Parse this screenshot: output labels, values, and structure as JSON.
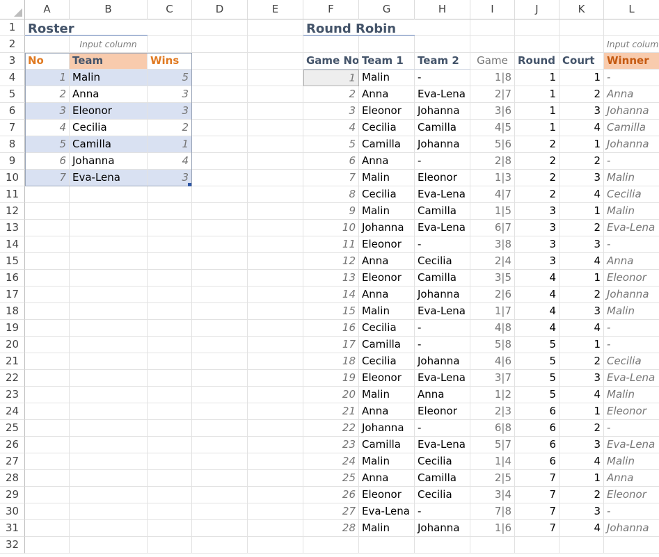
{
  "columns": [
    "A",
    "B",
    "C",
    "D",
    "E",
    "F",
    "G",
    "H",
    "I",
    "J",
    "K",
    "L"
  ],
  "rows": [
    1,
    2,
    3,
    4,
    5,
    6,
    7,
    8,
    9,
    10,
    11,
    12,
    13,
    14,
    15,
    16,
    17,
    18,
    19,
    20,
    21,
    22,
    23,
    24,
    25,
    26,
    27,
    28,
    29,
    30,
    31,
    32
  ],
  "roster": {
    "title": "Roster",
    "input_label": "Input column",
    "headers": {
      "no": "No",
      "team": "Team",
      "wins": "Wins"
    },
    "teams": [
      {
        "no": 1,
        "team": "Malin",
        "wins": 5
      },
      {
        "no": 2,
        "team": "Anna",
        "wins": 3
      },
      {
        "no": 3,
        "team": "Eleonor",
        "wins": 3
      },
      {
        "no": 4,
        "team": "Cecilia",
        "wins": 2
      },
      {
        "no": 5,
        "team": "Camilla",
        "wins": 1
      },
      {
        "no": 6,
        "team": "Johanna",
        "wins": 4
      },
      {
        "no": 7,
        "team": "Eva-Lena",
        "wins": 3
      }
    ]
  },
  "round_robin": {
    "title": "Round Robin",
    "input_label": "Input column",
    "headers": {
      "game_no": "Game No",
      "team1": "Team 1",
      "team2": "Team 2",
      "game": "Game",
      "round": "Round",
      "court": "Court",
      "winner": "Winner"
    },
    "games": [
      {
        "no": 1,
        "team1": "Malin",
        "team2": "-",
        "game": "1|8",
        "round": 1,
        "court": 1,
        "winner": "-"
      },
      {
        "no": 2,
        "team1": "Anna",
        "team2": "Eva-Lena",
        "game": "2|7",
        "round": 1,
        "court": 2,
        "winner": "Anna"
      },
      {
        "no": 3,
        "team1": "Eleonor",
        "team2": "Johanna",
        "game": "3|6",
        "round": 1,
        "court": 3,
        "winner": "Johanna"
      },
      {
        "no": 4,
        "team1": "Cecilia",
        "team2": "Camilla",
        "game": "4|5",
        "round": 1,
        "court": 4,
        "winner": "Camilla"
      },
      {
        "no": 5,
        "team1": "Camilla",
        "team2": "Johanna",
        "game": "5|6",
        "round": 2,
        "court": 1,
        "winner": "Johanna"
      },
      {
        "no": 6,
        "team1": "Anna",
        "team2": "-",
        "game": "2|8",
        "round": 2,
        "court": 2,
        "winner": "-"
      },
      {
        "no": 7,
        "team1": "Malin",
        "team2": "Eleonor",
        "game": "1|3",
        "round": 2,
        "court": 3,
        "winner": "Malin"
      },
      {
        "no": 8,
        "team1": "Cecilia",
        "team2": "Eva-Lena",
        "game": "4|7",
        "round": 2,
        "court": 4,
        "winner": "Cecilia"
      },
      {
        "no": 9,
        "team1": "Malin",
        "team2": "Camilla",
        "game": "1|5",
        "round": 3,
        "court": 1,
        "winner": "Malin"
      },
      {
        "no": 10,
        "team1": "Johanna",
        "team2": "Eva-Lena",
        "game": "6|7",
        "round": 3,
        "court": 2,
        "winner": "Eva-Lena"
      },
      {
        "no": 11,
        "team1": "Eleonor",
        "team2": "-",
        "game": "3|8",
        "round": 3,
        "court": 3,
        "winner": "-"
      },
      {
        "no": 12,
        "team1": "Anna",
        "team2": "Cecilia",
        "game": "2|4",
        "round": 3,
        "court": 4,
        "winner": "Anna"
      },
      {
        "no": 13,
        "team1": "Eleonor",
        "team2": "Camilla",
        "game": "3|5",
        "round": 4,
        "court": 1,
        "winner": "Eleonor"
      },
      {
        "no": 14,
        "team1": "Anna",
        "team2": "Johanna",
        "game": "2|6",
        "round": 4,
        "court": 2,
        "winner": "Johanna"
      },
      {
        "no": 15,
        "team1": "Malin",
        "team2": "Eva-Lena",
        "game": "1|7",
        "round": 4,
        "court": 3,
        "winner": "Malin"
      },
      {
        "no": 16,
        "team1": "Cecilia",
        "team2": "-",
        "game": "4|8",
        "round": 4,
        "court": 4,
        "winner": "-"
      },
      {
        "no": 17,
        "team1": "Camilla",
        "team2": "-",
        "game": "5|8",
        "round": 5,
        "court": 1,
        "winner": "-"
      },
      {
        "no": 18,
        "team1": "Cecilia",
        "team2": "Johanna",
        "game": "4|6",
        "round": 5,
        "court": 2,
        "winner": "Cecilia"
      },
      {
        "no": 19,
        "team1": "Eleonor",
        "team2": "Eva-Lena",
        "game": "3|7",
        "round": 5,
        "court": 3,
        "winner": "Eva-Lena"
      },
      {
        "no": 20,
        "team1": "Malin",
        "team2": "Anna",
        "game": "1|2",
        "round": 5,
        "court": 4,
        "winner": "Malin"
      },
      {
        "no": 21,
        "team1": "Anna",
        "team2": "Eleonor",
        "game": "2|3",
        "round": 6,
        "court": 1,
        "winner": "Eleonor"
      },
      {
        "no": 22,
        "team1": "Johanna",
        "team2": "-",
        "game": "6|8",
        "round": 6,
        "court": 2,
        "winner": "-"
      },
      {
        "no": 23,
        "team1": "Camilla",
        "team2": "Eva-Lena",
        "game": "5|7",
        "round": 6,
        "court": 3,
        "winner": "Eva-Lena"
      },
      {
        "no": 24,
        "team1": "Malin",
        "team2": "Cecilia",
        "game": "1|4",
        "round": 6,
        "court": 4,
        "winner": "Malin"
      },
      {
        "no": 25,
        "team1": "Anna",
        "team2": "Camilla",
        "game": "2|5",
        "round": 7,
        "court": 1,
        "winner": "Anna"
      },
      {
        "no": 26,
        "team1": "Eleonor",
        "team2": "Cecilia",
        "game": "3|4",
        "round": 7,
        "court": 2,
        "winner": "Eleonor"
      },
      {
        "no": 27,
        "team1": "Eva-Lena",
        "team2": "-",
        "game": "7|8",
        "round": 7,
        "court": 3,
        "winner": "-"
      },
      {
        "no": 28,
        "team1": "Malin",
        "team2": "Johanna",
        "game": "1|6",
        "round": 7,
        "court": 4,
        "winner": "Johanna"
      }
    ]
  }
}
